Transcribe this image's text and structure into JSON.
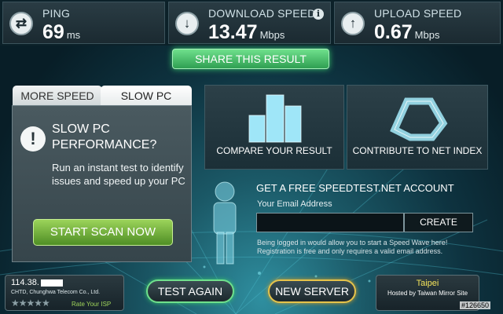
{
  "metrics": {
    "ping": {
      "label": "PING",
      "value": "69",
      "unit": "ms",
      "icon": "ping-icon"
    },
    "download": {
      "label": "DOWNLOAD SPEED",
      "value": "13.47",
      "unit": "Mbps",
      "icon": "download-arrow-icon",
      "info": "i"
    },
    "upload": {
      "label": "UPLOAD SPEED",
      "value": "0.67",
      "unit": "Mbps",
      "icon": "upload-arrow-icon"
    }
  },
  "share_label": "SHARE THIS RESULT",
  "tabs": {
    "more_speed": "MORE SPEED",
    "slow_pc": "SLOW PC"
  },
  "slow_pc": {
    "warn_glyph": "!",
    "title": "SLOW PC PERFORMANCE?",
    "description": "Run an instant test to identify issues and speed up your PC",
    "button": "START SCAN NOW"
  },
  "tiles": {
    "compare": "COMPARE YOUR RESULT",
    "contribute": "CONTRIBUTE TO NET INDEX"
  },
  "account": {
    "title": "GET A FREE SPEEDTEST.NET ACCOUNT",
    "email_label": "Your Email Address",
    "email_value": "",
    "create": "CREATE",
    "note": "Being logged in would allow you to start a Speed Wave here! Registration is free and only requires a valid email address."
  },
  "isp": {
    "ip": "114.38.",
    "name": "CHTD, Chunghwa Telecom Co., Ltd.",
    "stars": "★★★★★",
    "rate": "Rate Your ISP"
  },
  "buttons": {
    "test_again": "TEST AGAIN",
    "new_server": "NEW SERVER"
  },
  "server": {
    "city": "Taipei",
    "host": "Hosted by Taiwan Mirror Site"
  },
  "watermark": "#126650",
  "colors": {
    "accent_green": "#39c46a",
    "server_gold": "#e6c34a",
    "city_yellow": "#f4e35a"
  }
}
